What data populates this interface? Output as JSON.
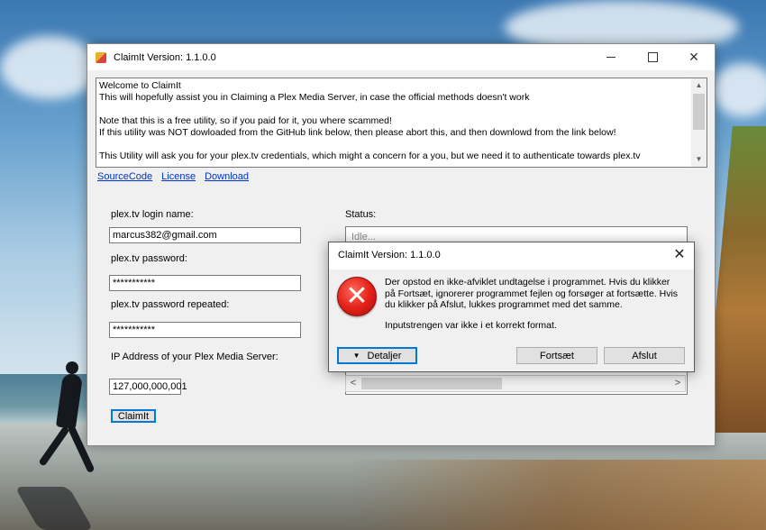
{
  "window": {
    "title": "ClaimIt Version: 1.1.0.0",
    "intro_text": "Welcome to ClaimIt\nThis will hopefully assist you in Claiming a Plex Media Server, in case the official methods doesn't work\n\nNote that this is a free utility, so if you paid for it, you where scammed!\nIf this utility was NOT dowloaded from the GitHub link below, then please abort this, and then downlowd from the link below!\n\nThis Utility will ask you for your plex.tv credentials, which might a concern for a you, but we need it to authenticate towards plex.tv"
  },
  "links": {
    "source": "SourceCode",
    "license": "License",
    "download": "Download"
  },
  "form": {
    "login_label": "plex.tv login name:",
    "login_value": "marcus382@gmail.com",
    "password_label": "plex.tv password:",
    "password_value": "***********",
    "password_repeat_label": "plex.tv password repeated:",
    "password_repeat_value": "***********",
    "ip_label": "IP Address of your Plex Media Server:",
    "ip_value": "127,000,000,001",
    "claim_button": "ClaimIt"
  },
  "status": {
    "label": "Status:",
    "line": "Idle..."
  },
  "dialog": {
    "title": "ClaimIt Version: 1.1.0.0",
    "message": "Der opstod en ikke-afviklet undtagelse i programmet. Hvis du klikker på Fortsæt, ignorerer programmet fejlen og forsøger at fortsætte. Hvis du klikker på Afslut, lukkes programmet med det samme.",
    "detail": "Inputstrengen var ikke i et korrekt format.",
    "details_button": "Detaljer",
    "continue_button": "Fortsæt",
    "quit_button": "Afslut"
  },
  "icons": {
    "app": "app-icon",
    "error": "error-icon",
    "close": "close-icon"
  },
  "colors": {
    "link": "#0033cc",
    "error_red": "#e4231a",
    "focus_blue": "#0078d7"
  }
}
